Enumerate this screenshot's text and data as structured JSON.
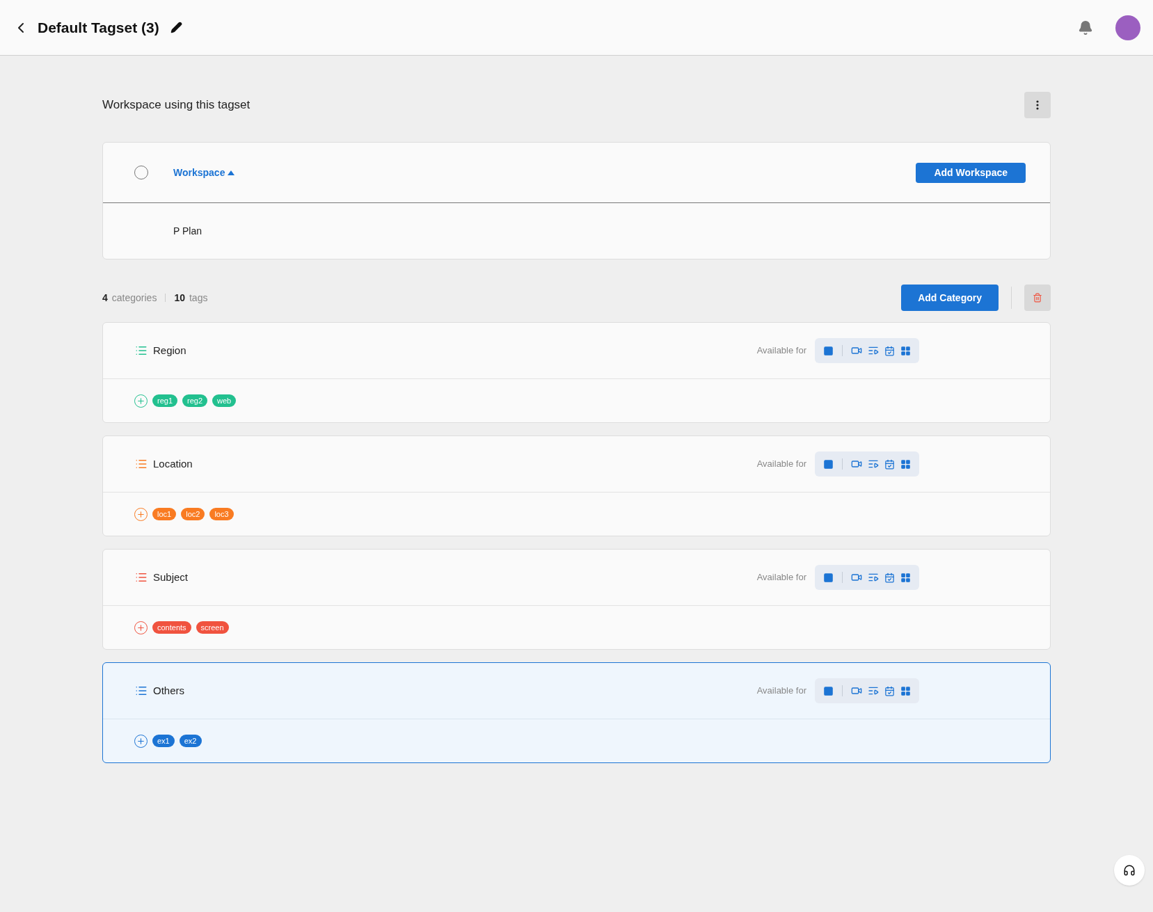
{
  "header": {
    "title": "Default Tagset (3)"
  },
  "workspace_section": {
    "title": "Workspace using this tagset",
    "table": {
      "select_all_checked": false,
      "column": {
        "label": "Workspace",
        "sort_ascending": true
      },
      "add_button": "Add Workspace",
      "rows": [
        {
          "name": "P Plan"
        }
      ]
    }
  },
  "summary": {
    "categories_count": "4",
    "categories_label": "categories",
    "tags_count": "10",
    "tags_label": "tags",
    "add_button": "Add Category"
  },
  "categories": [
    {
      "name": "Region",
      "color": "#22c08f",
      "selected": false,
      "available_label": "Available for",
      "tags": [
        "reg1",
        "reg2",
        "web"
      ]
    },
    {
      "name": "Location",
      "color": "#f97b22",
      "selected": false,
      "available_label": "Available for",
      "tags": [
        "loc1",
        "loc2",
        "loc3"
      ]
    },
    {
      "name": "Subject",
      "color": "#f0533f",
      "selected": false,
      "available_label": "Available for",
      "tags": [
        "contents",
        "screen"
      ]
    },
    {
      "name": "Others",
      "color": "#1c74d4",
      "selected": true,
      "available_label": "Available for",
      "tags": [
        "ex1",
        "ex2"
      ]
    }
  ]
}
